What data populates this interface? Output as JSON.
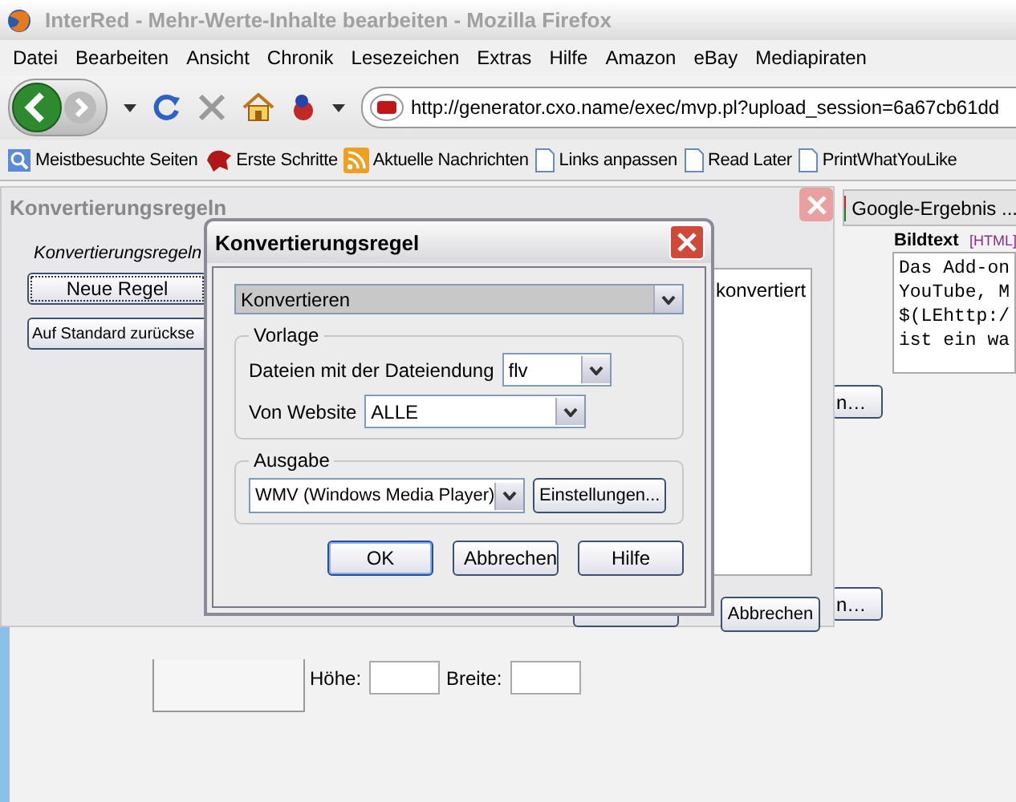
{
  "window": {
    "title": "InterRed - Mehr-Werte-Inhalte bearbeiten - Mozilla Firefox"
  },
  "menu": [
    "Datei",
    "Bearbeiten",
    "Ansicht",
    "Chronik",
    "Lesezeichen",
    "Extras",
    "Hilfe",
    "Amazon",
    "eBay",
    "Mediapiraten"
  ],
  "address_bar": {
    "value": "http://generator.cxo.name/exec/mvp.pl?upload_session=6a67cb61dd"
  },
  "bookmarks": [
    {
      "label": "Meistbesuchte Seiten",
      "kind": "search"
    },
    {
      "label": "Erste Schritte",
      "kind": "dog"
    },
    {
      "label": "Aktuelle Nachrichten",
      "kind": "rss"
    },
    {
      "label": "Links anpassen",
      "kind": "page"
    },
    {
      "label": "Read Later",
      "kind": "page"
    },
    {
      "label": "PrintWhatYouLike",
      "kind": "page"
    }
  ],
  "page": {
    "tab": "Google-Ergebnis ...",
    "caption_label": "Bildtext",
    "caption_tag": "[HTML]",
    "caption_lines": [
      "Das Add-on",
      "YouTube, M",
      "$(LEhttp:/",
      "ist ein wa"
    ],
    "side_buttons": [
      "n…",
      "n…"
    ],
    "height_label": "Höhe:",
    "width_label": "Breite:"
  },
  "rules_window": {
    "title": "Konvertierungsregeln",
    "list_label": "Konvertierungsregeln",
    "buttons": [
      "Neue Regel",
      "Auf Standard zurückse"
    ],
    "list_items": [
      "konvertiert"
    ],
    "cancel_button": "Abbrechen"
  },
  "rule_dialog": {
    "title": "Konvertierungsregel",
    "action": "Konvertieren",
    "template_group": "Vorlage",
    "extension_label": "Dateien mit der Dateiendung",
    "extension": "flv",
    "website_label": "Von Website",
    "website": "ALLE",
    "output_group": "Ausgabe",
    "output_format": "WMV (Windows Media Player)",
    "settings_button": "Einstellungen...",
    "buttons": [
      "OK",
      "Abbrechen",
      "Hilfe"
    ]
  }
}
